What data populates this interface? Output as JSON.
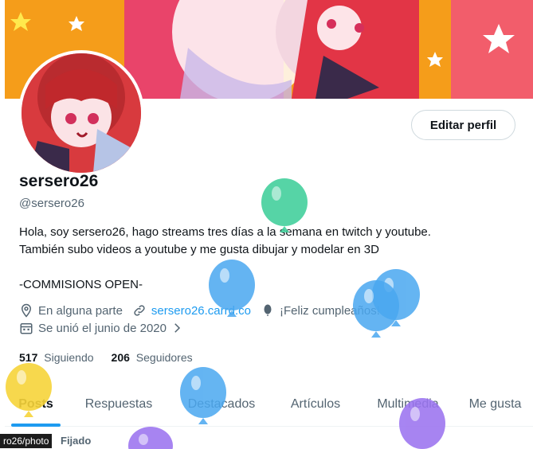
{
  "profile": {
    "display_name": "sersero26",
    "handle": "@sersero26",
    "edit_label": "Editar perfil",
    "bio_lines": [
      "Hola, soy sersero26, hago streams tres días a la semana en twitch y youtube.",
      "También subo videos a youtube y me gusta dibujar y modelar en 3D",
      "-COMMISIONS OPEN-"
    ],
    "location": "En alguna parte",
    "website": "sersero26.carrd.co",
    "birthday": "¡Feliz cumpleaños!",
    "joined": "Se unió el junio de 2020",
    "following_count": "517",
    "following_label": "Siguiendo",
    "followers_count": "206",
    "followers_label": "Seguidores"
  },
  "tabs": [
    "Posts",
    "Respuestas",
    "Destacados",
    "Artículos",
    "Multimedia",
    "Me gusta"
  ],
  "pinned_label": "Fijado",
  "url_tooltip": "ro26/photo",
  "icons": [
    "location-pin-icon",
    "link-icon",
    "balloon-icon",
    "calendar-icon",
    "chevron-right-icon"
  ],
  "colors": {
    "accent": "#1d9bf0",
    "text_primary": "#0f1419",
    "text_secondary": "#536471",
    "balloon_green": "#3fcf9a",
    "balloon_blue": "#4aa8f0",
    "balloon_yellow": "#f7d43a",
    "balloon_purple": "#9b74f0"
  }
}
